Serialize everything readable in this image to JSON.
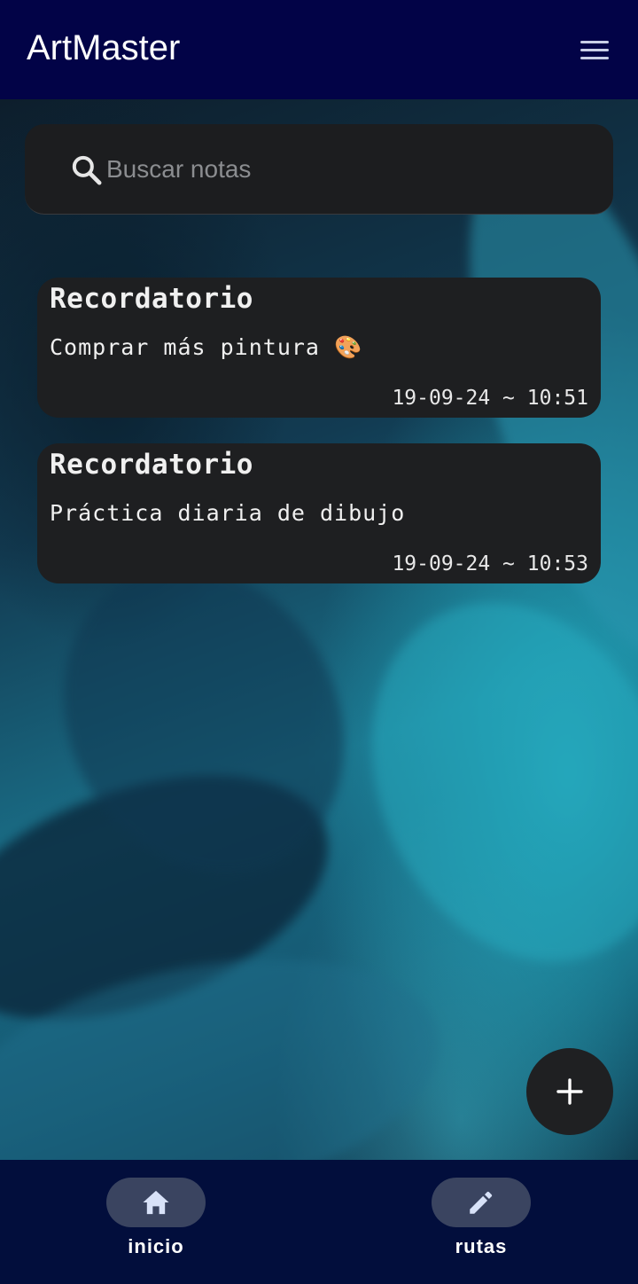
{
  "app": {
    "title": "ArtMaster"
  },
  "search": {
    "placeholder": "Buscar notas"
  },
  "notes": [
    {
      "title": "Recordatorio",
      "body": "Comprar más pintura 🎨",
      "datetime": "19-09-24 ~ 10:51"
    },
    {
      "title": "Recordatorio",
      "body": "Práctica diaria de dibujo",
      "datetime": "19-09-24 ~ 10:53"
    }
  ],
  "fab": {
    "icon": "plus-icon"
  },
  "nav": {
    "items": [
      {
        "label": "inicio",
        "icon": "home-icon",
        "selected": true
      },
      {
        "label": "rutas",
        "icon": "pencil-icon",
        "selected": false
      }
    ]
  },
  "colors": {
    "appbar": "#020347",
    "navbar": "#020e3c",
    "card": "#1e1f21",
    "nav_pill": "#3a4460"
  }
}
